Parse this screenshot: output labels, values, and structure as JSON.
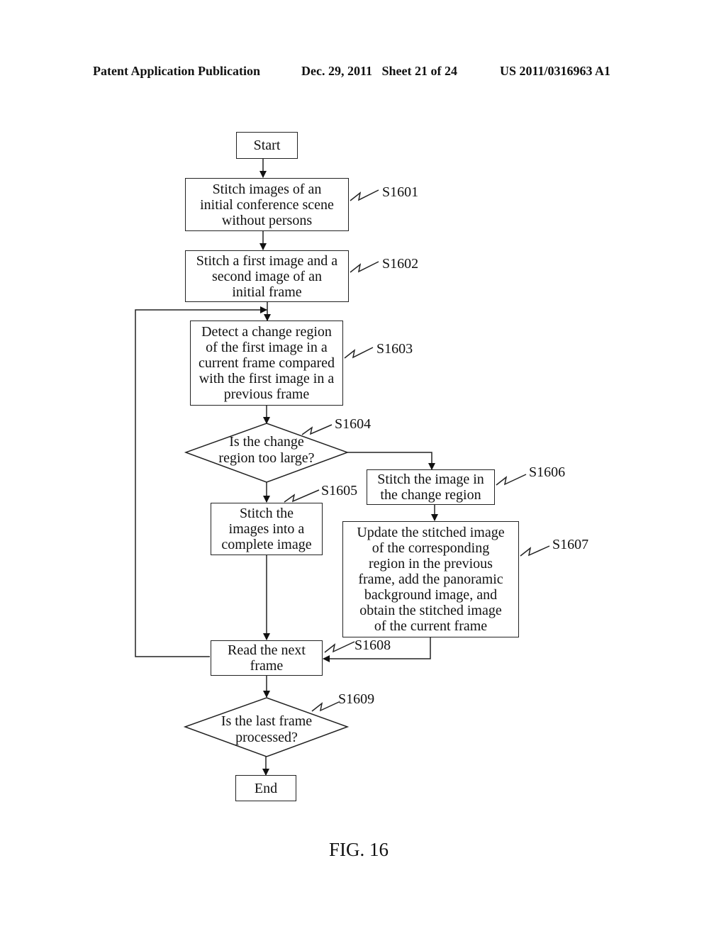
{
  "header": {
    "publication": "Patent Application Publication",
    "date_sheet": "Dec. 29, 2011   Sheet 21 of 24",
    "number": "US 2011/0316963 A1"
  },
  "figure_label": "FIG. 16",
  "flowchart": {
    "start": "Start",
    "end": "End",
    "steps": [
      {
        "id": "S1601",
        "type": "process",
        "text": "Stitch images of an\ninitial conference scene\nwithout persons"
      },
      {
        "id": "S1602",
        "type": "process",
        "text": "Stitch a first image and a\nsecond image of an\ninitial frame"
      },
      {
        "id": "S1603",
        "type": "process",
        "text": "Detect a change region\nof the first image in a\ncurrent frame compared\nwith the first image in a\nprevious frame"
      },
      {
        "id": "S1604",
        "type": "decision",
        "text": "Is the change\nregion too large?"
      },
      {
        "id": "S1605",
        "type": "process",
        "text": "Stitch the\nimages into a\ncomplete image"
      },
      {
        "id": "S1606",
        "type": "process",
        "text": "Stitch the image in\nthe change region"
      },
      {
        "id": "S1607",
        "type": "process",
        "text": "Update the stitched image\nof the corresponding\nregion in the previous\nframe, add the panoramic\nbackground image, and\nobtain the stitched image\nof the current frame"
      },
      {
        "id": "S1608",
        "type": "process",
        "text": "Read the next\nframe"
      },
      {
        "id": "S1609",
        "type": "decision",
        "text": "Is the last frame\nprocessed?"
      }
    ]
  }
}
